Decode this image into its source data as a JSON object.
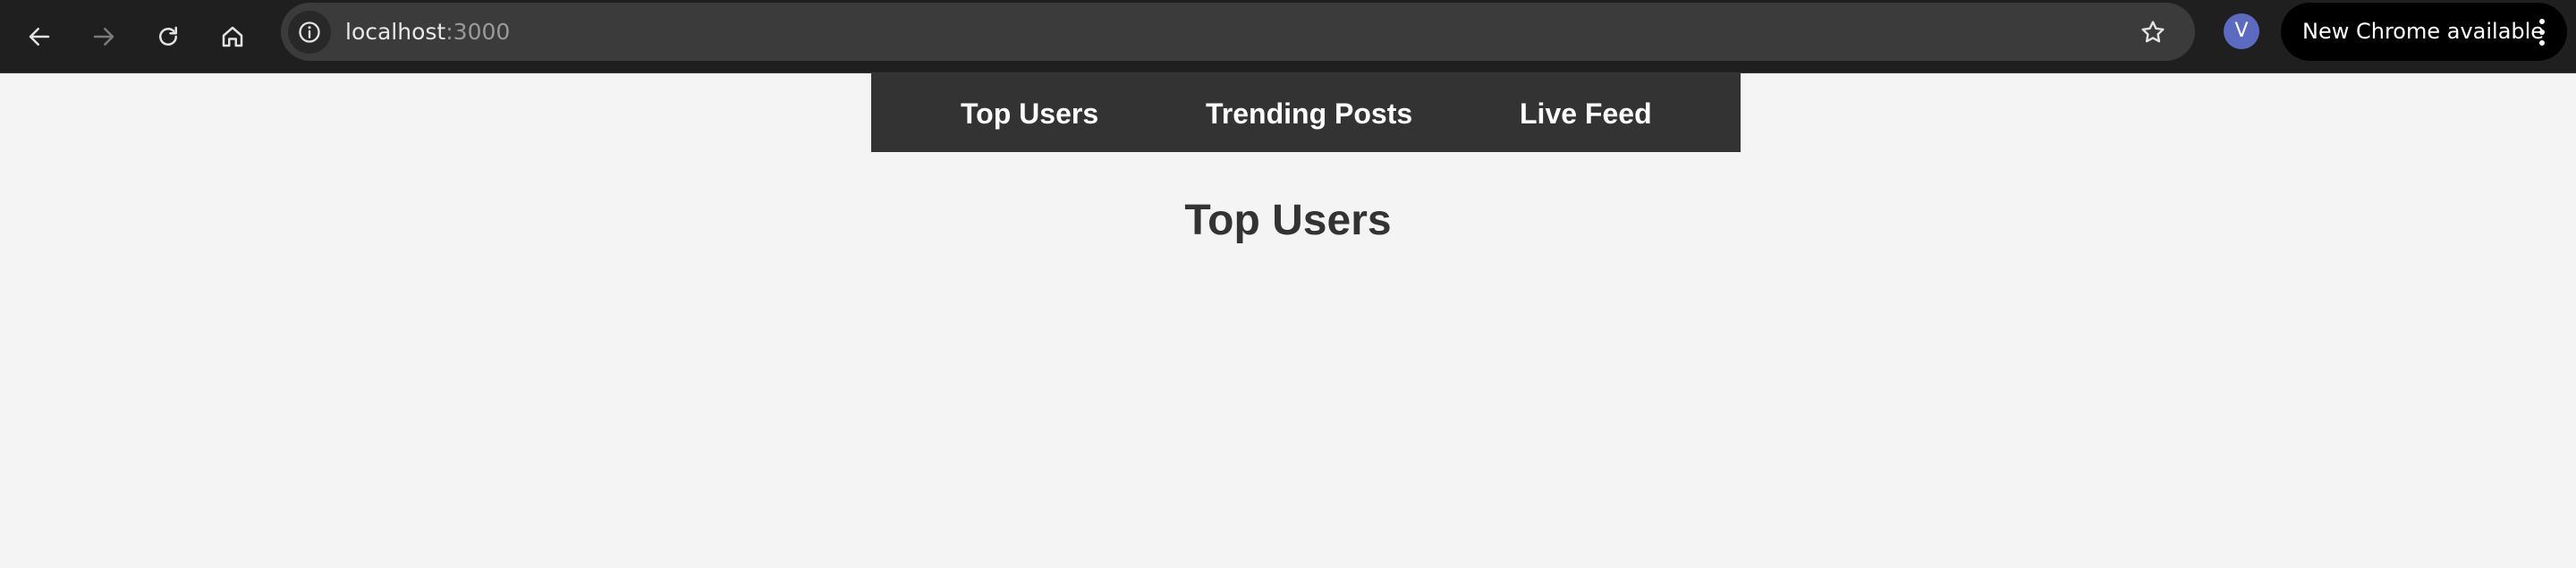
{
  "browser": {
    "url_host": "localhost",
    "url_port": ":3000",
    "profile_initial": "V",
    "update_label": "New Chrome available",
    "icons": {
      "back": "back-arrow-icon",
      "forward": "forward-arrow-icon",
      "reload": "reload-icon",
      "home": "home-icon",
      "site_info": "info-icon",
      "bookmark": "star-icon",
      "menu": "kebab-menu-icon"
    }
  },
  "nav": {
    "items": [
      {
        "label": "Top Users"
      },
      {
        "label": "Trending Posts"
      },
      {
        "label": "Live Feed"
      }
    ]
  },
  "main": {
    "title": "Top Users"
  },
  "colors": {
    "page_background": "#f4f4f4",
    "nav_background": "#333333",
    "nav_text": "#ffffff",
    "title_text": "#333333",
    "browser_bar": "#1f1f1f",
    "omnibox": "#3b3b3b",
    "avatar": "#5c6bc0"
  }
}
